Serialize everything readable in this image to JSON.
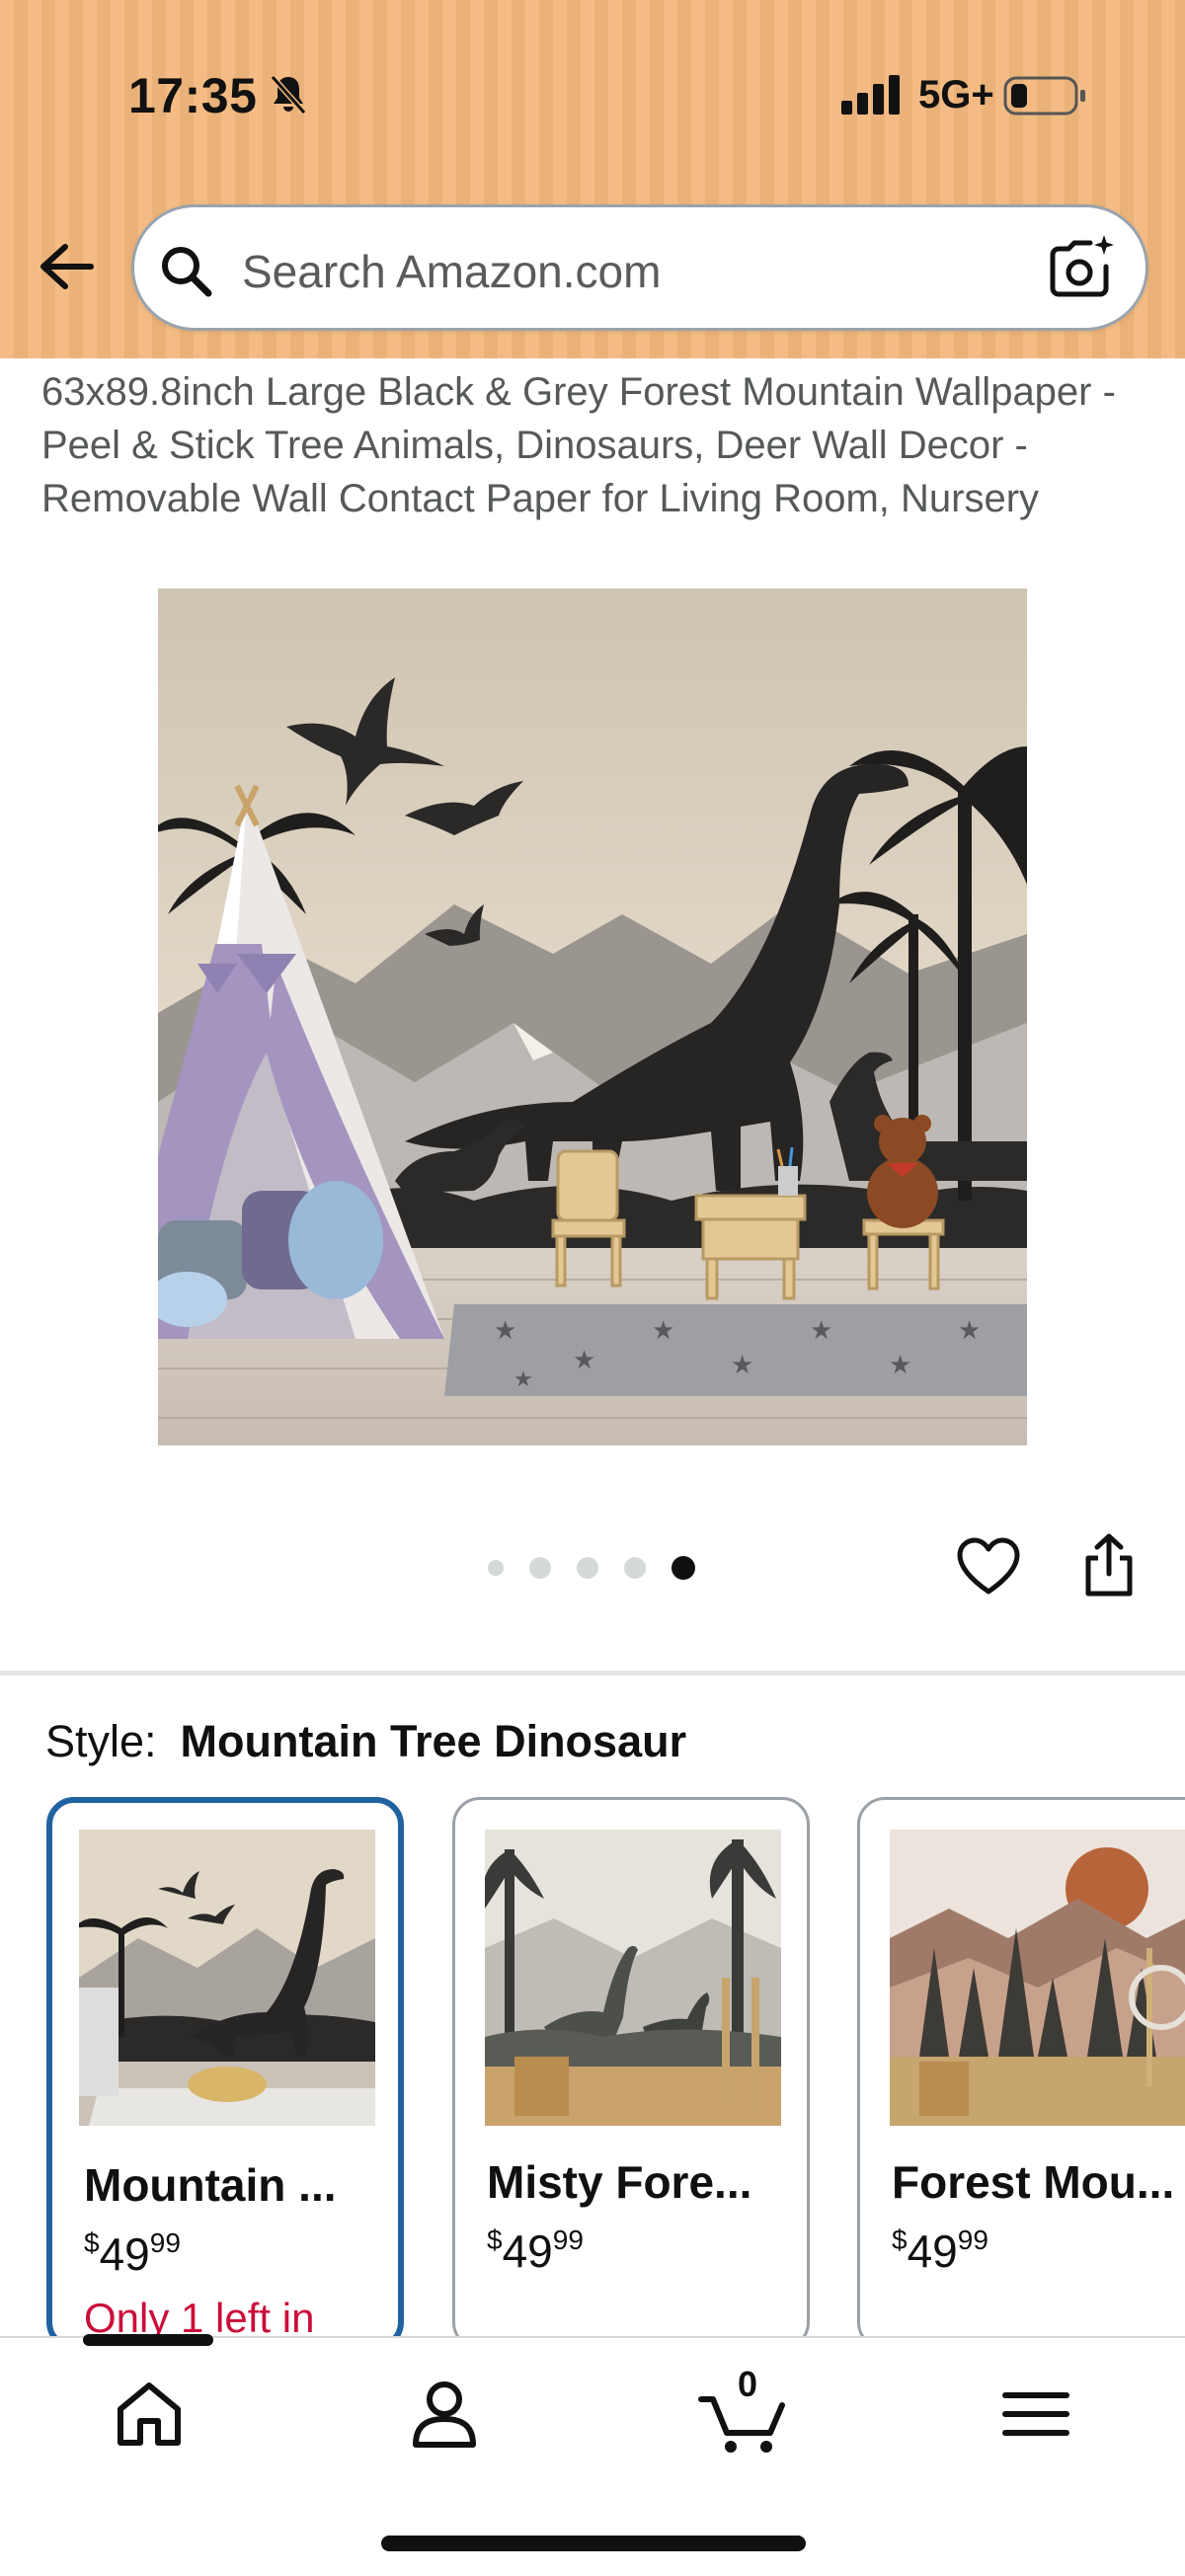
{
  "status_bar": {
    "time": "17:35",
    "network": "5G+",
    "icons": [
      "bell-slash-icon",
      "signal-bars-icon",
      "battery-icon"
    ]
  },
  "search": {
    "placeholder": "Search Amazon.com",
    "icons": [
      "back-arrow-icon",
      "search-icon",
      "camera-lens-icon"
    ]
  },
  "product": {
    "title": "63x89.8inch Large Black & Grey Forest Mountain Wallpaper - Peel & Stick Tree Animals, Dinosaurs, Deer Wall Decor - Removable Wall Contact Paper for Living Room, Nursery"
  },
  "gallery": {
    "image_count": 5,
    "active_index": 4,
    "actions": [
      "heart-icon",
      "share-icon"
    ]
  },
  "style_selector": {
    "label": "Style:",
    "selected_value": "Mountain Tree Dinosaur",
    "options": [
      {
        "name": "Mountain ...",
        "price_currency": "$",
        "price_whole": "49",
        "price_fraction": "99",
        "stock": "Only 1 left in",
        "selected": true
      },
      {
        "name": "Misty Fore...",
        "price_currency": "$",
        "price_whole": "49",
        "price_fraction": "99",
        "stock": "",
        "selected": false
      },
      {
        "name": "Forest Mou...",
        "price_currency": "$",
        "price_whole": "49",
        "price_fraction": "99",
        "stock": "",
        "selected": false
      }
    ]
  },
  "bottom_nav": {
    "items": [
      "home-icon",
      "account-icon",
      "cart-icon",
      "menu-icon"
    ],
    "cart_count": "0",
    "active": "home-icon"
  },
  "colors": {
    "header_bg": "#f3b87c",
    "selected_border": "#2162a1",
    "stock_warning": "#cc0c39",
    "text_primary": "#0f1111",
    "text_secondary": "#565959"
  }
}
